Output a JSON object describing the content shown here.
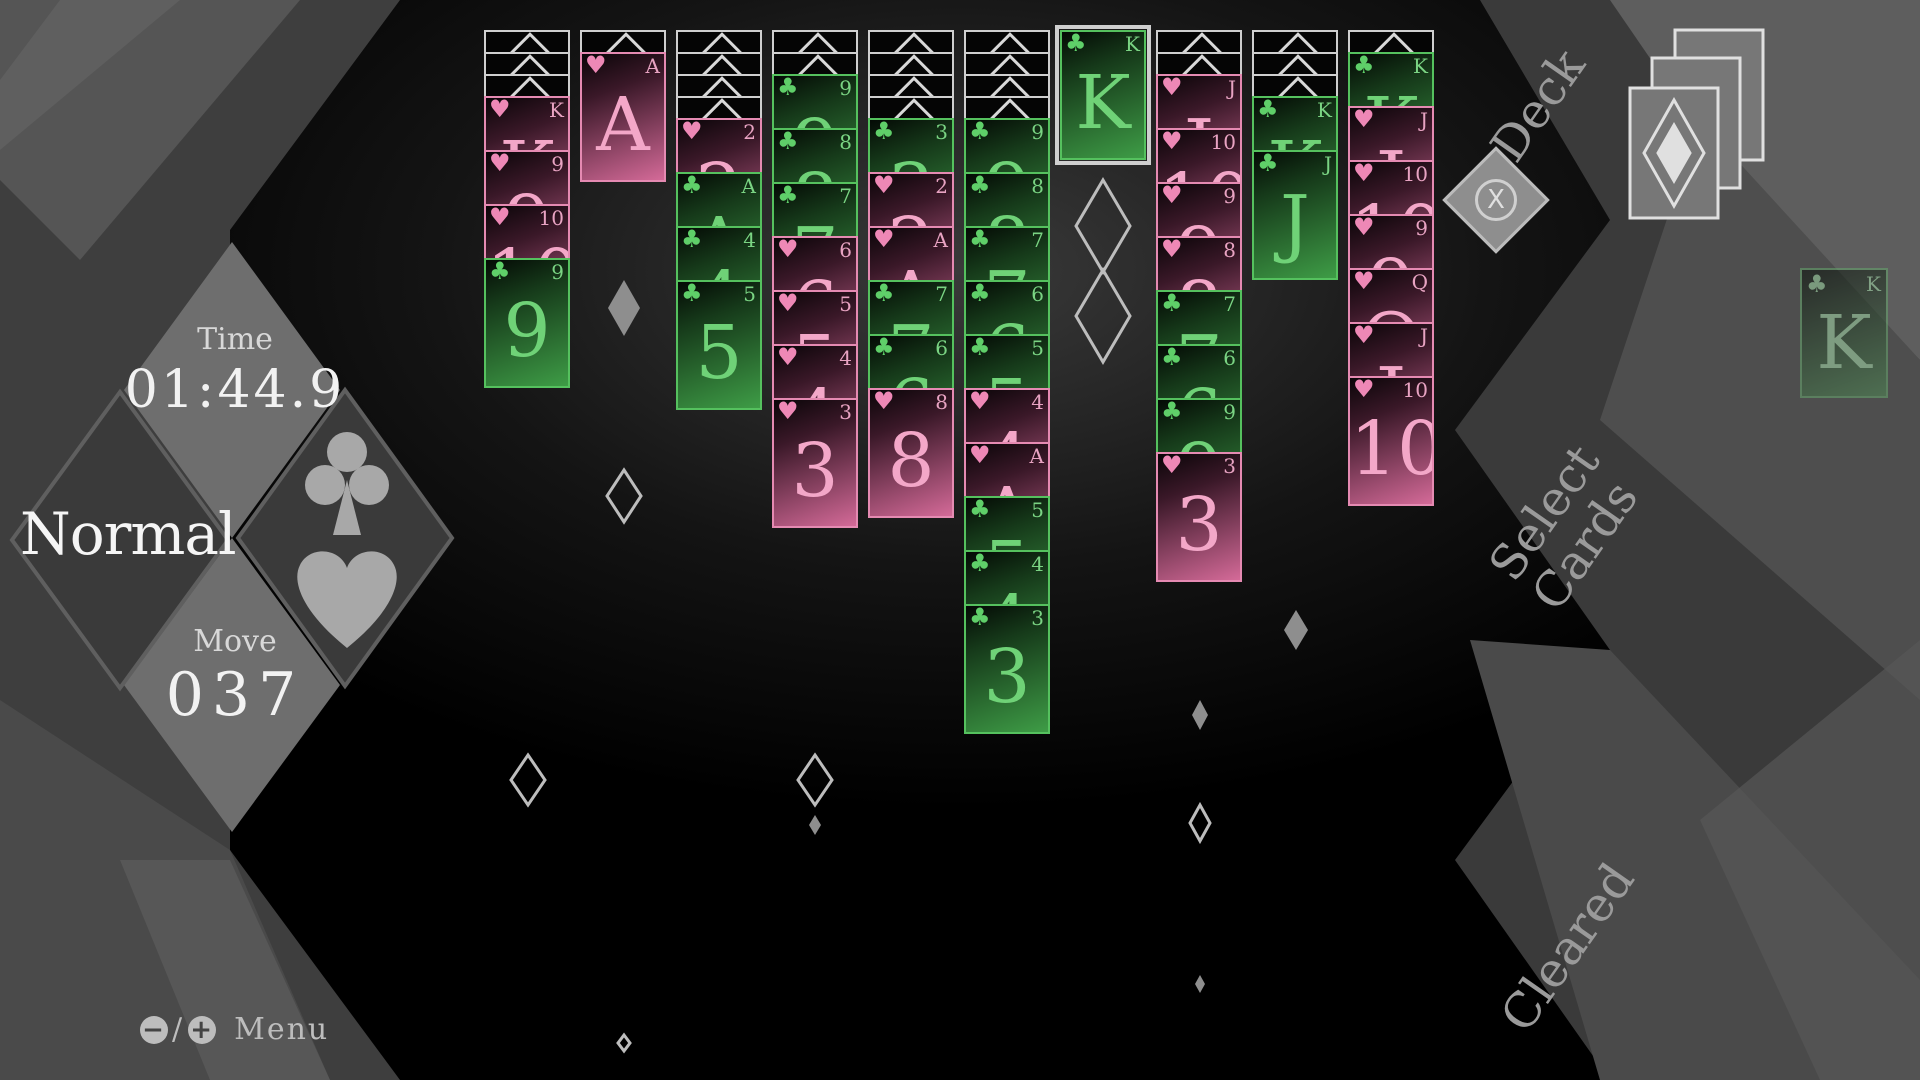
{
  "hud": {
    "time_label": "Time",
    "time_value": "01:44.9",
    "mode": "Normal",
    "move_label": "Move",
    "move_value": "037",
    "suits_shown": [
      "club",
      "heart"
    ],
    "menu_minus": "−",
    "menu_plus": "+",
    "menu_separator": "/",
    "menu_label": "Menu"
  },
  "side_panel": {
    "deck_label": "Deck",
    "x_button_label": "X",
    "select_label_line1": "Select",
    "select_label_line2": "Cards",
    "cleared_label": "Cleared",
    "cleared_card": {
      "rank": "K",
      "suit": "club",
      "color": "green"
    }
  },
  "colors": {
    "pink_card": "#d46a98",
    "green_card": "#3e9c46",
    "panel_gray": "#5a5a5a",
    "background": "#000000"
  },
  "tableau": [
    {
      "hidden": 3,
      "cards": [
        [
          "K",
          "heart"
        ],
        [
          "9",
          "heart"
        ],
        [
          "10",
          "heart"
        ],
        [
          "9",
          "club"
        ]
      ]
    },
    {
      "hidden": 1,
      "cards": [
        [
          "A",
          "heart"
        ]
      ]
    },
    {
      "hidden": 4,
      "cards": [
        [
          "2",
          "heart"
        ],
        [
          "A",
          "club"
        ],
        [
          "4",
          "club"
        ],
        [
          "5",
          "club"
        ]
      ]
    },
    {
      "hidden": 2,
      "cards": [
        [
          "9",
          "club"
        ],
        [
          "8",
          "club"
        ],
        [
          "7",
          "club"
        ],
        [
          "6",
          "heart"
        ],
        [
          "5",
          "heart"
        ],
        [
          "4",
          "heart"
        ],
        [
          "3",
          "heart"
        ]
      ]
    },
    {
      "hidden": 4,
      "cards": [
        [
          "3",
          "club"
        ],
        [
          "2",
          "heart"
        ],
        [
          "A",
          "heart"
        ],
        [
          "7",
          "club"
        ],
        [
          "6",
          "club"
        ],
        [
          "8",
          "heart"
        ]
      ]
    },
    {
      "hidden": 4,
      "cards": [
        [
          "9",
          "club"
        ],
        [
          "8",
          "club"
        ],
        [
          "7",
          "club"
        ],
        [
          "6",
          "club"
        ],
        [
          "5",
          "club"
        ],
        [
          "4",
          "heart"
        ],
        [
          "A",
          "heart"
        ],
        [
          "5",
          "club"
        ],
        [
          "4",
          "club"
        ],
        [
          "3",
          "club"
        ]
      ]
    },
    {
      "hidden": 0,
      "cards": [
        [
          "K",
          "club"
        ]
      ],
      "highlighted": true
    },
    {
      "hidden": 2,
      "cards": [
        [
          "J",
          "heart"
        ],
        [
          "10",
          "heart"
        ],
        [
          "9",
          "heart"
        ],
        [
          "8",
          "heart"
        ],
        [
          "7",
          "club"
        ],
        [
          "6",
          "club"
        ],
        [
          "9",
          "club"
        ],
        [
          "3",
          "heart"
        ]
      ]
    },
    {
      "hidden": 3,
      "cards": [
        [
          "K",
          "club"
        ],
        [
          "J",
          "club"
        ]
      ]
    },
    {
      "hidden": 1,
      "cards": [
        [
          "K",
          "club"
        ],
        [
          "J",
          "heart"
        ],
        [
          "10",
          "heart"
        ],
        [
          "9",
          "heart"
        ],
        [
          "Q",
          "heart"
        ],
        [
          "J",
          "heart"
        ],
        [
          "10",
          "heart"
        ]
      ]
    }
  ]
}
